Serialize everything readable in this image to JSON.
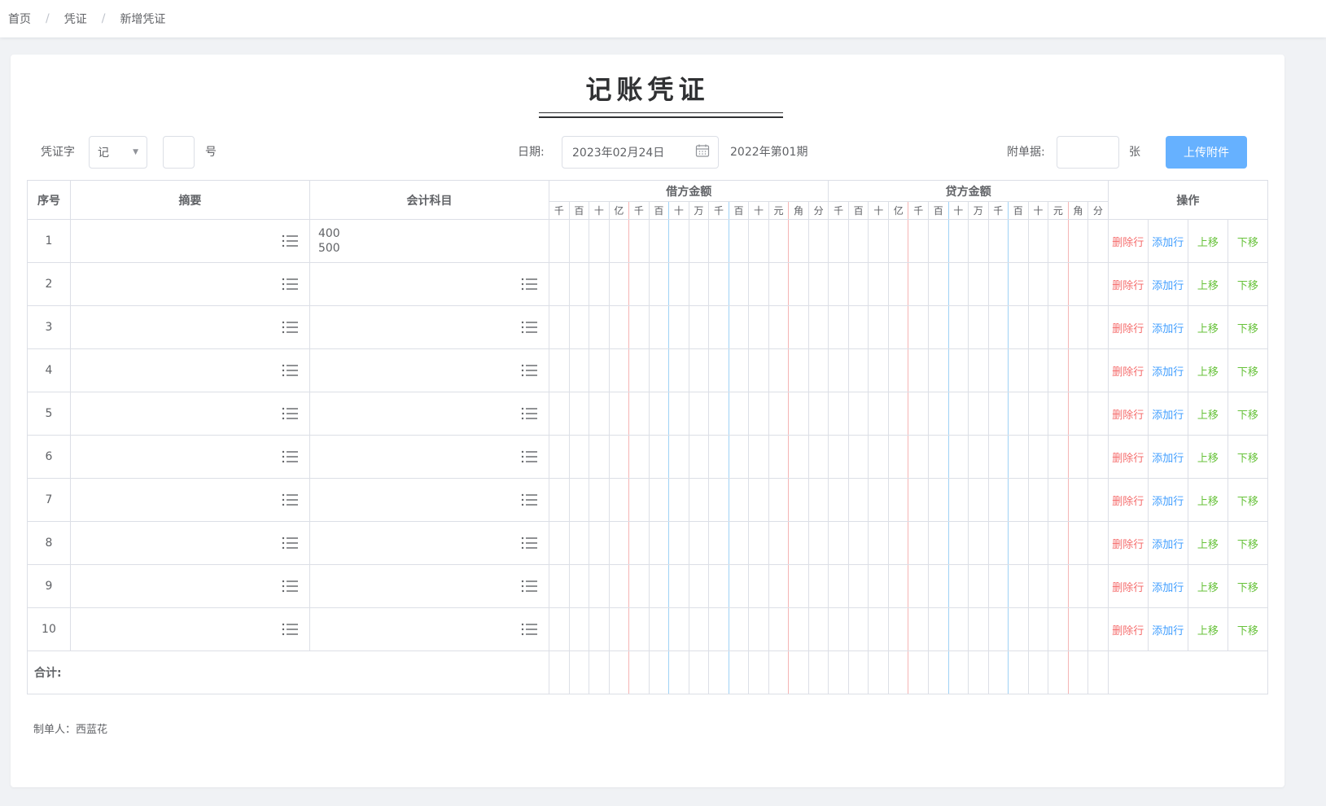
{
  "breadcrumb": [
    "首页",
    "凭证",
    "新增凭证"
  ],
  "title": "记账凭证",
  "header": {
    "voucher_word_label": "凭证字",
    "voucher_word_value": "记",
    "number_value": "",
    "number_suffix": "号",
    "date_label": "日期:",
    "date_value": "2023年02月24日",
    "period": "2022年第01期",
    "attachments_label": "附单据:",
    "attachments_value": "",
    "attachments_suffix": "张",
    "upload_button": "上传附件"
  },
  "columns": {
    "index": "序号",
    "summary": "摘要",
    "subject": "会计科目",
    "debit": "借方金额",
    "credit": "贷方金额",
    "ops": "操作",
    "digits": [
      "千",
      "百",
      "十",
      "亿",
      "千",
      "百",
      "十",
      "万",
      "千",
      "百",
      "十",
      "元",
      "角",
      "分"
    ]
  },
  "rows": [
    {
      "index": "1",
      "summary": "",
      "subject": [
        "400",
        "500"
      ]
    },
    {
      "index": "2",
      "summary": "",
      "subject": []
    },
    {
      "index": "3",
      "summary": "",
      "subject": []
    },
    {
      "index": "4",
      "summary": "",
      "subject": []
    },
    {
      "index": "5",
      "summary": "",
      "subject": []
    },
    {
      "index": "6",
      "summary": "",
      "subject": []
    },
    {
      "index": "7",
      "summary": "",
      "subject": []
    },
    {
      "index": "8",
      "summary": "",
      "subject": []
    },
    {
      "index": "9",
      "summary": "",
      "subject": []
    },
    {
      "index": "10",
      "summary": "",
      "subject": []
    }
  ],
  "row_actions": {
    "delete": "删除行",
    "add": "添加行",
    "up": "上移",
    "down": "下移"
  },
  "total_label": "合计:",
  "maker": "制单人：西蓝花",
  "colors": {
    "delete": "#f56c6c",
    "add": "#409eff",
    "move": "#67c23a",
    "upload_button": "#66b1ff"
  }
}
